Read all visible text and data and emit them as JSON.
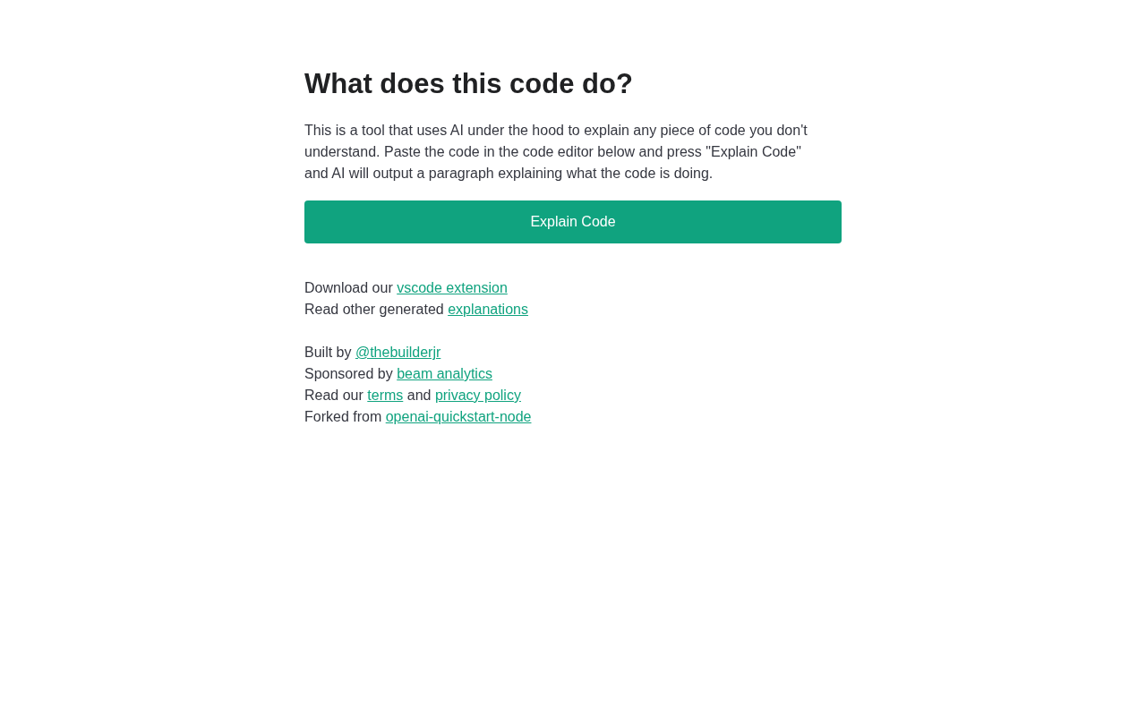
{
  "title": "What does this code do?",
  "intro": "This is a tool that uses AI under the hood to explain any piece of code you don't understand. Paste the code in the code editor below and press \"Explain Code\" and AI will output a paragraph explaining what the code is doing.",
  "button": {
    "label": "Explain Code"
  },
  "link_groups": [
    {
      "lines": [
        {
          "parts": [
            {
              "kind": "text",
              "text": "Download our"
            },
            {
              "kind": "link",
              "text": "vscode extension"
            }
          ]
        },
        {
          "parts": [
            {
              "kind": "text",
              "text": "Read other generated"
            },
            {
              "kind": "link",
              "text": "explanations"
            }
          ]
        }
      ]
    },
    {
      "lines": [
        {
          "parts": [
            {
              "kind": "text",
              "text": "Built by"
            },
            {
              "kind": "link",
              "text": "@thebuilderjr"
            }
          ]
        },
        {
          "parts": [
            {
              "kind": "text",
              "text": "Sponsored by"
            },
            {
              "kind": "link",
              "text": "beam analytics"
            }
          ]
        },
        {
          "parts": [
            {
              "kind": "text",
              "text": "Read our"
            },
            {
              "kind": "link",
              "text": "terms"
            },
            {
              "kind": "text",
              "text": "and"
            },
            {
              "kind": "link",
              "text": "privacy policy"
            }
          ]
        },
        {
          "parts": [
            {
              "kind": "text",
              "text": "Forked from"
            },
            {
              "kind": "link",
              "text": "openai-quickstart-node"
            }
          ]
        }
      ]
    }
  ]
}
